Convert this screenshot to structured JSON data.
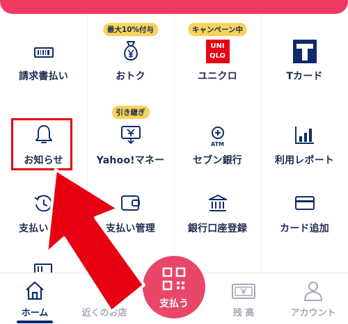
{
  "grid": {
    "items": [
      {
        "label": "請求書払い",
        "icon": "bill-scan-icon"
      },
      {
        "label": "おトク",
        "icon": "money-bag-yen-icon",
        "badge": "最大10%付与"
      },
      {
        "label": "ユニクロ",
        "icon": "uniqlo-logo",
        "badge": "キャンペーン中",
        "logo_lines": [
          "UNI",
          "QLO"
        ]
      },
      {
        "label": "Tカード",
        "icon": "t-card-logo"
      },
      {
        "label": "お知らせ",
        "icon": "bell-icon"
      },
      {
        "label": "Yahoo!マネー",
        "icon": "yahoo-money-icon",
        "badge": "引き継ぎ"
      },
      {
        "label": "セブン銀行",
        "icon": "atm-icon",
        "icon_text": "ATM"
      },
      {
        "label": "利用レポート",
        "icon": "bar-chart-icon"
      },
      {
        "label": "支払い履歴",
        "icon": "history-clock-icon"
      },
      {
        "label": "支払い管理",
        "icon": "wallet-icon"
      },
      {
        "label": "銀行口座登録",
        "icon": "bank-icon"
      },
      {
        "label": "カード追加",
        "icon": "credit-card-icon"
      }
    ]
  },
  "tabbar": {
    "tabs": [
      {
        "label": "ホーム",
        "icon": "home-icon",
        "active": true
      },
      {
        "label": "近くのお店",
        "icon": "map-pin-icon",
        "active": false
      },
      {
        "label": "支払う",
        "icon": "qr-code-icon",
        "active": false
      },
      {
        "label": "残 高",
        "icon": "banknote-yen-icon",
        "active": false
      },
      {
        "label": "アカウント",
        "icon": "user-icon",
        "active": false
      }
    ]
  },
  "colors": {
    "brand_pink": "#ee3a62",
    "navy": "#1d2b4f",
    "badge_yellow": "#f8d35b",
    "pay_button": "#e8476a",
    "annotation_red": "#e60012"
  }
}
